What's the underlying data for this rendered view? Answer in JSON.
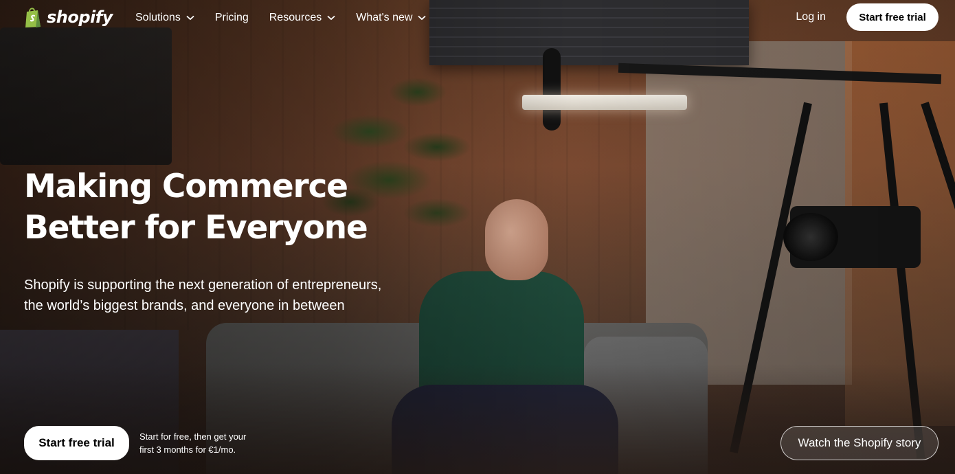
{
  "header": {
    "logo_text": "shopify",
    "nav": [
      {
        "label": "Solutions",
        "has_dropdown": true
      },
      {
        "label": "Pricing",
        "has_dropdown": false
      },
      {
        "label": "Resources",
        "has_dropdown": true
      },
      {
        "label": "What's new",
        "has_dropdown": true
      }
    ],
    "login_label": "Log in",
    "cta_label": "Start free trial"
  },
  "hero": {
    "title_line1": "Making Commerce",
    "title_line2": "Better for Everyone",
    "subtitle_line1": "Shopify is supporting the next generation of entrepreneurs,",
    "subtitle_line2": "the world’s biggest brands, and everyone in between",
    "cta_label": "Start free trial",
    "cta_note_line1": "Start for free, then get your",
    "cta_note_line2": "first 3 months for €1/mo.",
    "watch_label": "Watch the Shopify story"
  },
  "colors": {
    "logo_green": "#95bf47",
    "logo_dark_green": "#5e8e3e",
    "text": "#ffffff",
    "button_bg": "#ffffff",
    "button_text": "#000000"
  },
  "icons": [
    "shopify-bag-icon",
    "chevron-down-icon"
  ]
}
